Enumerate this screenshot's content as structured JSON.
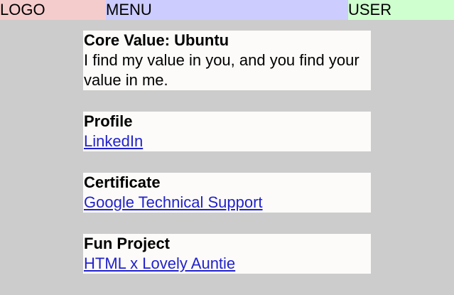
{
  "header": {
    "logo": "LOGO",
    "menu": "MENU",
    "user": "USER"
  },
  "core_value": {
    "title": "Core Value: Ubuntu",
    "text": "I find my value in you, and you find your value in me."
  },
  "profile": {
    "title": "Profile",
    "link": "LinkedIn"
  },
  "certificate": {
    "title": "Certificate",
    "link": "Google Technical Support"
  },
  "fun_project": {
    "title": "Fun Project",
    "link": "HTML x Lovely Auntie"
  },
  "colors": {
    "background": "#cccccc",
    "logo_bg": "#f5cccc",
    "menu_bg": "#ccccff",
    "user_bg": "#cfffcf",
    "card_bg": "#fcfbf9",
    "link": "#2222cc"
  }
}
